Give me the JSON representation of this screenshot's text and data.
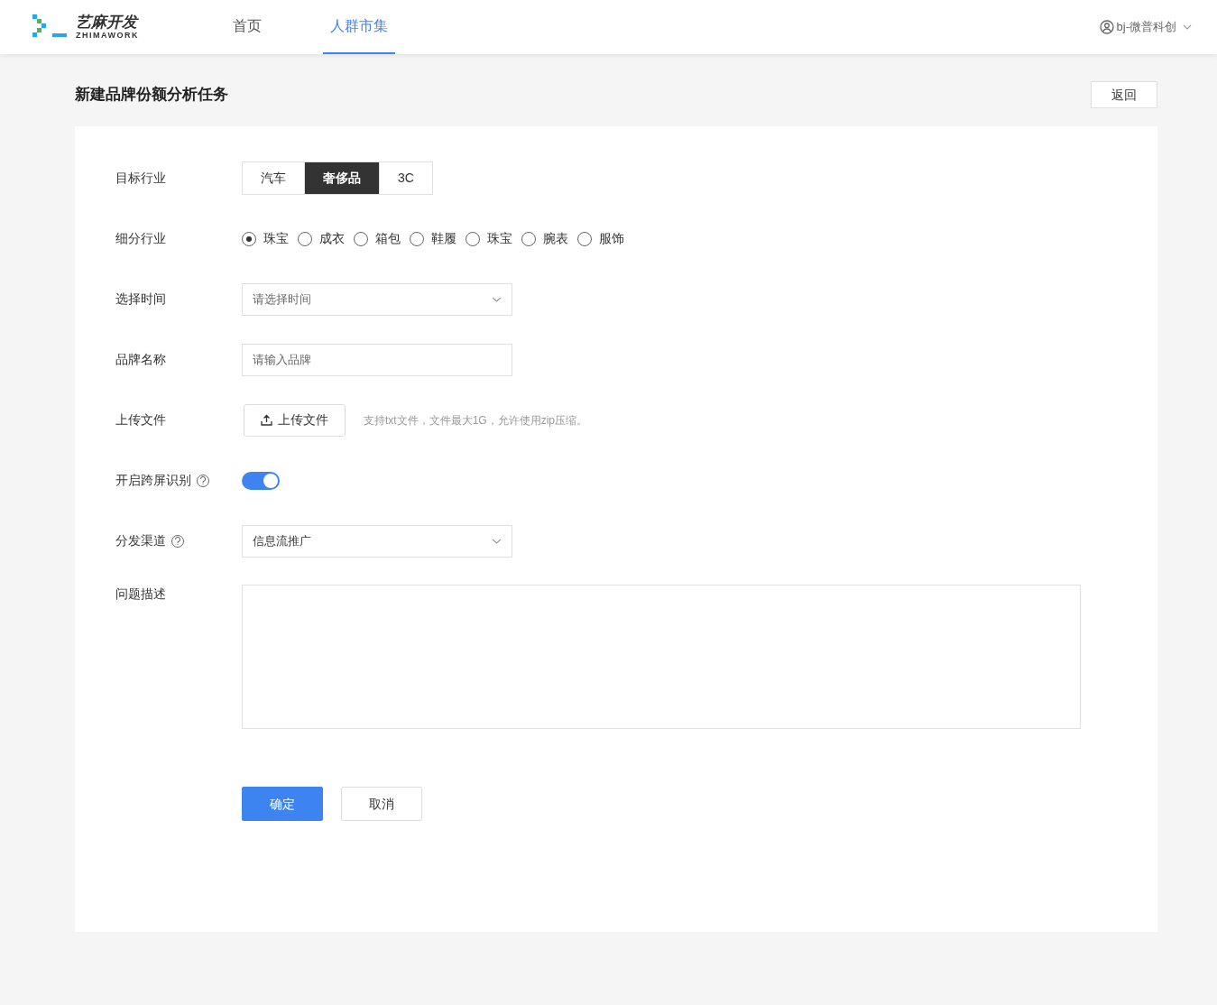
{
  "header": {
    "logo": {
      "title": "艺麻开发",
      "subtitle": "ZHIMAWORK"
    },
    "nav": [
      {
        "label": "首页",
        "selected": false
      },
      {
        "label": "人群市集",
        "selected": true
      }
    ],
    "user": "bj-微普科创"
  },
  "page": {
    "title": "新建品牌份额分析任务",
    "back_button": "返回"
  },
  "form": {
    "fields": [
      {
        "kind": "segmented",
        "label": "目标行业",
        "options": [
          {
            "label": "汽车",
            "selected": false
          },
          {
            "label": "奢侈品",
            "selected": true
          },
          {
            "label": "3C",
            "selected": false
          }
        ]
      },
      {
        "kind": "radio",
        "label": "细分行业",
        "options": [
          {
            "label": "珠宝",
            "selected": true
          },
          {
            "label": "成衣",
            "selected": false
          },
          {
            "label": "箱包",
            "selected": false
          },
          {
            "label": "鞋履",
            "selected": false
          },
          {
            "label": "珠宝",
            "selected": false
          },
          {
            "label": "腕表",
            "selected": false
          },
          {
            "label": "服饰",
            "selected": false
          }
        ]
      },
      {
        "kind": "select",
        "label": "选择时间",
        "placeholder": "请选择时间"
      },
      {
        "kind": "input",
        "label": "品牌名称",
        "placeholder": "请输入品牌"
      },
      {
        "kind": "upload",
        "label": "上传文件",
        "button": "上传文件",
        "hint": "支持txt文件，文件最大1G，允许使用zip压缩。"
      },
      {
        "kind": "switch",
        "label": "开启跨屏识别",
        "help": true,
        "on": true
      },
      {
        "kind": "select",
        "label": "分发渠道",
        "help": true,
        "value": "信息流推广"
      },
      {
        "kind": "textarea",
        "label": "问题描述"
      }
    ],
    "submit": "确定",
    "cancel": "取消"
  }
}
